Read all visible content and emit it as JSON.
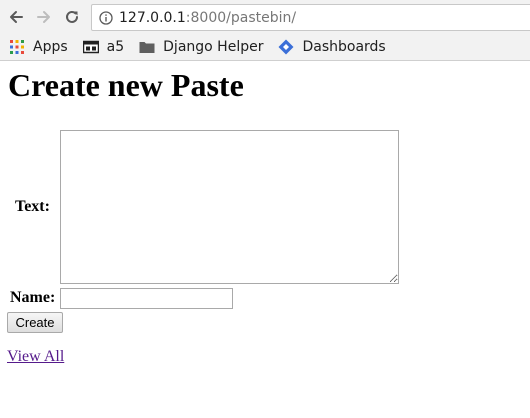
{
  "browser": {
    "url_host": "127.0.0.1",
    "url_rest": ":8000/pastebin/",
    "bookmarks": [
      {
        "label": "Apps",
        "icon": "apps-grid-icon"
      },
      {
        "label": "a5",
        "icon": "bookmark-page-icon"
      },
      {
        "label": "Django Helper",
        "icon": "folder-icon"
      },
      {
        "label": "Dashboards",
        "icon": "dashboards-diamond-icon"
      }
    ]
  },
  "page": {
    "title": "Create new Paste",
    "text_label": "Text:",
    "text_value": "",
    "name_label": "Name:",
    "name_value": "",
    "create_label": "Create",
    "view_all_label": "View All"
  },
  "colors": {
    "link_visited": "#551a8b",
    "chrome_bg": "#f2f2f2",
    "dashboards_blue": "#3b6fd8"
  }
}
